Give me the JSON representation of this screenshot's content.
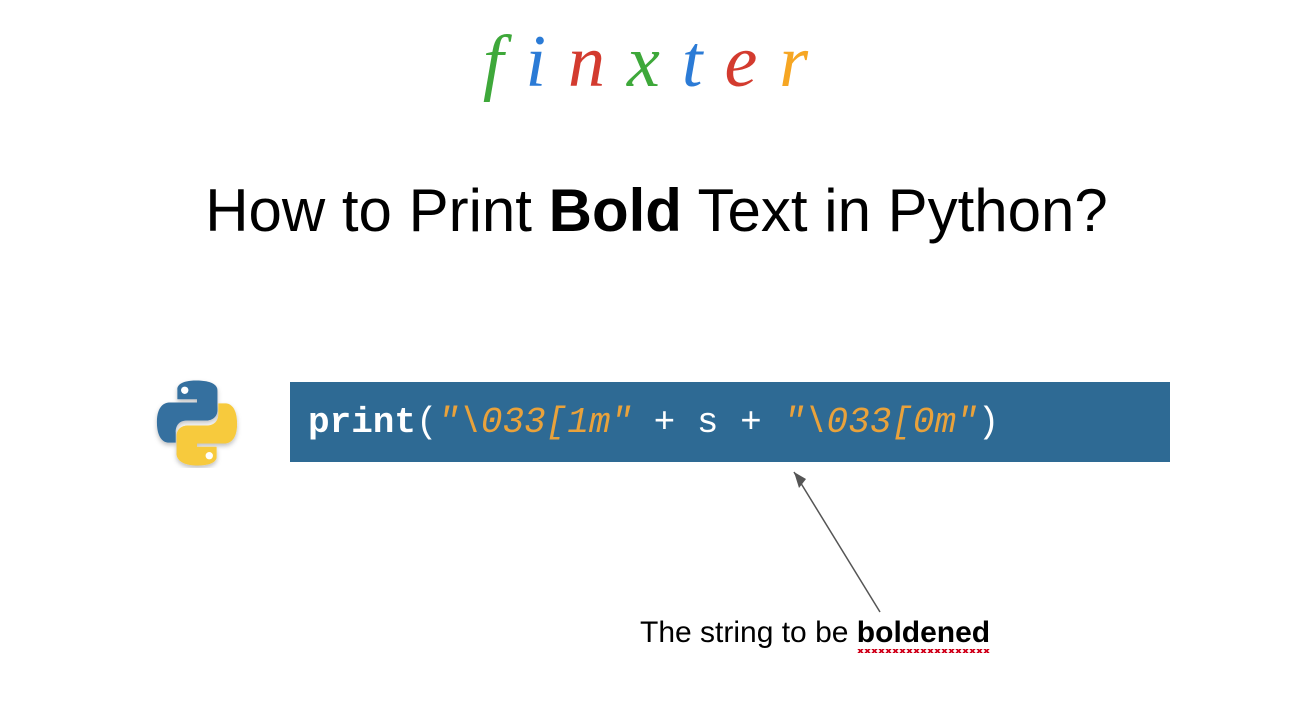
{
  "logo": {
    "letters": [
      {
        "char": "f",
        "color": "#3ea83a"
      },
      {
        "char": "i",
        "color": "#2b7bd6"
      },
      {
        "char": "n",
        "color": "#d33b2f"
      },
      {
        "char": "x",
        "color": "#3ea83a"
      },
      {
        "char": "t",
        "color": "#2b7bd6"
      },
      {
        "char": "e",
        "color": "#d33b2f"
      },
      {
        "char": "r",
        "color": "#f6a623"
      }
    ]
  },
  "title": {
    "prefix": "How to Print ",
    "bold": "Bold",
    "suffix": " Text in Python?"
  },
  "code": {
    "keyword": "print",
    "open_paren": "(",
    "string1": "\"\\033[1m\"",
    "operator": " + s + ",
    "string2": "\"\\033[0m\"",
    "close_paren": ")"
  },
  "annotation": {
    "prefix": "The string to be ",
    "bold_word": "boldened"
  },
  "colors": {
    "code_bg": "#2e6a94",
    "code_string": "#e9a23b",
    "python_blue": "#366f9f",
    "python_yellow": "#f7ca3e"
  }
}
